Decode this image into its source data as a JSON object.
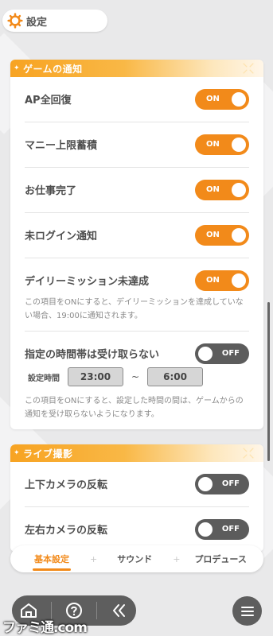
{
  "header": {
    "title": "設定",
    "icon": "gear-icon"
  },
  "colors": {
    "accent": "#f28a1a",
    "toggle_off": "#5c5c5c"
  },
  "sections": {
    "game_notifications": {
      "title": "ゲームの通知",
      "rows": [
        {
          "label": "AP全回復",
          "state": "ON"
        },
        {
          "label": "マニー上限蓄積",
          "state": "ON"
        },
        {
          "label": "お仕事完了",
          "state": "ON"
        },
        {
          "label": "未ログイン通知",
          "state": "ON"
        },
        {
          "label": "デイリーミッション未達成",
          "state": "ON",
          "note": "この項目をONにすると、デイリーミッションを達成していない場合、19:00に通知されます。"
        },
        {
          "label": "指定の時間帯は受け取らない",
          "state": "OFF",
          "time_label": "設定時間",
          "start_time": "23:00",
          "tilde": "~",
          "end_time": "6:00",
          "note": "この項目をONにすると、設定した時間の間は、ゲームからの通知を受け取らないようになります。"
        }
      ]
    },
    "live_capture": {
      "title": "ライブ撮影",
      "rows": [
        {
          "label": "上下カメラの反転",
          "state": "OFF"
        },
        {
          "label": "左右カメラの反転",
          "state": "OFF"
        }
      ]
    }
  },
  "tabs": [
    {
      "label": "基本設定",
      "active": true
    },
    {
      "label": "サウンド",
      "active": false
    },
    {
      "label": "プロデュース",
      "active": false
    }
  ],
  "tab_separator": "+",
  "bottom_nav": {
    "icons": [
      "home-icon",
      "help-icon",
      "back-icon"
    ],
    "menu_icon": "menu-icon"
  },
  "watermark": "ファミ通.com"
}
